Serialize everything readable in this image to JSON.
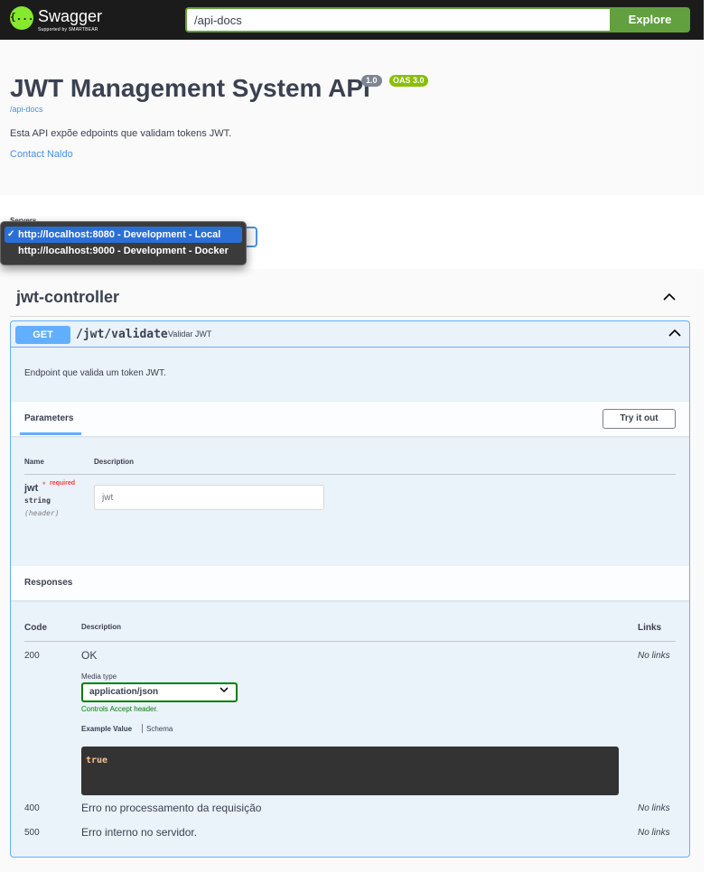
{
  "topbar": {
    "logo_name": "Swagger",
    "logo_sub": "Supported by SMARTBEAR",
    "logo_glyph": "{...}",
    "url_value": "/api-docs",
    "explore_label": "Explore"
  },
  "info": {
    "title": "JWT Management System API",
    "version": "1.0",
    "oas": "OAS 3.0",
    "docs_link": "/api-docs",
    "description": "Esta API expõe edpoints que validam tokens JWT.",
    "contact": "Contact Naldo"
  },
  "servers": {
    "label": "Servers",
    "options": [
      "http://localhost:8080 - Development - Local",
      "http://localhost:9000 - Development - Docker"
    ],
    "selected_index": 0,
    "check": "✓"
  },
  "tag": {
    "name": "jwt-controller",
    "chevron": "^"
  },
  "operation": {
    "method": "GET",
    "path": "/jwt/validate",
    "summary": "Validar JWT",
    "description": "Endpoint que valida um token JWT.",
    "parameters_tab": "Parameters",
    "try_it_out": "Try it out",
    "columns": {
      "name": "Name",
      "description": "Description"
    },
    "parameter": {
      "name": "jwt",
      "star": "*",
      "required": "required",
      "type": "string",
      "in": "(header)",
      "placeholder": "jwt"
    }
  },
  "responses": {
    "title": "Responses",
    "columns": {
      "code": "Code",
      "description": "Description",
      "links": "Links"
    },
    "rows": [
      {
        "code": "200",
        "description": "OK",
        "links": "No links"
      },
      {
        "code": "400",
        "description": "Erro no processamento da requisição",
        "links": "No links"
      },
      {
        "code": "500",
        "description": "Erro interno no servidor.",
        "links": "No links"
      }
    ],
    "media_type_label": "Media type",
    "media_type_value": "application/json",
    "controls_accept": "Controls Accept header.",
    "example_value_tab": "Example Value",
    "schema_tab": "Schema",
    "example_body": "true"
  },
  "colors": {
    "get": "#61affe",
    "explore": "#62a03f",
    "version_badge": "#7d8492",
    "oas_badge": "#89bf04"
  }
}
